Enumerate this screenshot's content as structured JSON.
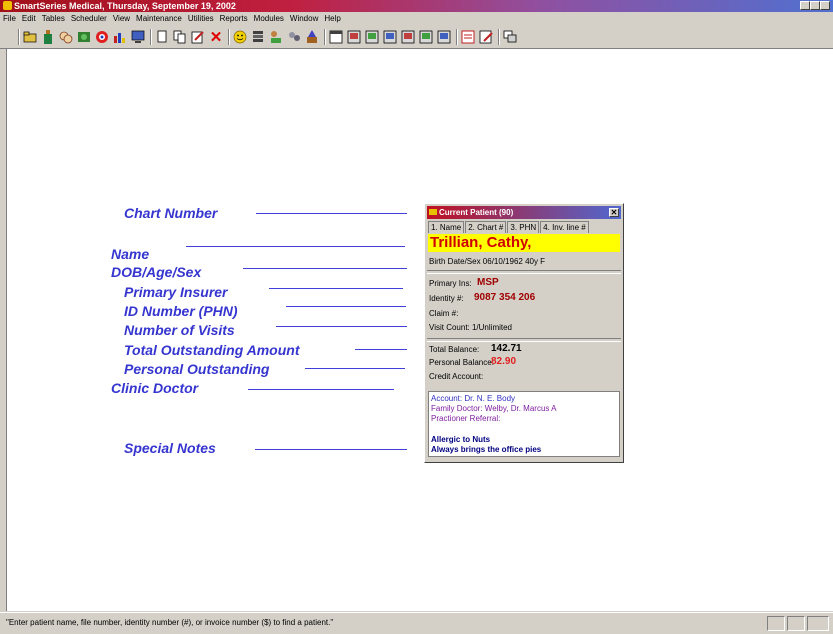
{
  "window": {
    "title": "SmartSeries Medical,  Thursday, September 19, 2002"
  },
  "menu": [
    "File",
    "Edit",
    "Tables",
    "Scheduler",
    "View",
    "Maintenance",
    "Utilities",
    "Reports",
    "Modules",
    "Window",
    "Help"
  ],
  "toolbar_icons": [
    "open-folder-icon",
    "bottle-icon",
    "hands-icon",
    "disk-icon",
    "target-icon",
    "bar-chart-icon",
    "monitor-icon",
    "new-doc-icon",
    "copy-doc-icon",
    "edit-doc-icon",
    "delete-icon",
    "smiley-icon",
    "stack-icon",
    "person-money-icon",
    "people-icon",
    "wizard-icon",
    "calendar-icon",
    "report-icon",
    "report-icon",
    "report-icon",
    "report-icon",
    "report-icon",
    "report-icon",
    "form-icon",
    "form-edit-icon",
    "window-copy-icon"
  ],
  "labels": {
    "chart_number": "Chart Number",
    "name": "Name",
    "dob_age_sex": "DOB/Age/Sex",
    "primary_insurer": "Primary Insurer",
    "id_number": "ID Number (PHN)",
    "number_of_visits": "Number of Visits",
    "total_outstanding": "Total Outstanding Amount",
    "personal_outstanding": "Personal Outstanding",
    "clinic_doctor": "Clinic Doctor",
    "special_notes": "Special Notes"
  },
  "patient_window": {
    "title": "Current Patient (90)",
    "tabs": [
      "1. Name",
      "2. Chart #",
      "3. PHN",
      "4. Inv. line #"
    ],
    "patient_name": "Trillian, Cathy,",
    "birth_line": "Birth Date/Sex 06/10/1962   40y     F",
    "primary_ins_label": "Primary Ins:",
    "primary_ins_value": "MSP",
    "identity_label": "Identity #:",
    "identity_value": "9087 354 206",
    "claim_label": "Claim #:",
    "visit_count": "Visit Count: 1/Unlimited",
    "total_balance_label": "Total Balance:",
    "total_balance_value": "142.71",
    "personal_balance_label": "Personal Balance:",
    "personal_balance_value": "82.90",
    "credit_account_label": "Credit Account:",
    "account": "Account: Dr. N. E. Body",
    "family_doctor": "Family Doctor: Welby, Dr. Marcus A",
    "practitioner_referral": "Practioner Referral:",
    "note1": "Allergic to Nuts",
    "note2": "Always brings the office pies",
    "colors": {
      "name_bg": "#ffff00",
      "name_text": "#d00000",
      "notes_text": "#000080",
      "doctor_text": "#8020a0"
    }
  },
  "status": {
    "text": "\"Enter patient name, file number, identity number (#), or invoice number ($) to find a patient.\""
  },
  "colors": {
    "label": "#3535d0",
    "line": "#4040d8"
  }
}
